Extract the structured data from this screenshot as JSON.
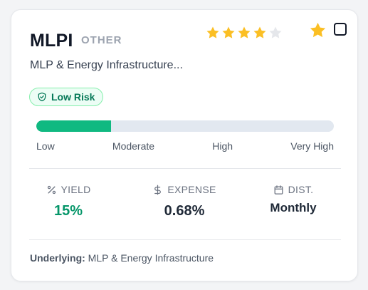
{
  "fund": {
    "ticker": "MLPI",
    "category": "OTHER",
    "name": "MLP & Energy Infrastructure...",
    "rating": 4,
    "rating_max": 5,
    "favorite": true,
    "selected": false
  },
  "risk": {
    "badge_label": "Low Risk",
    "level_fraction": 0.25,
    "levels": [
      "Low",
      "Moderate",
      "High",
      "Very High"
    ]
  },
  "stats": {
    "yield": {
      "label": "YIELD",
      "value": "15%"
    },
    "expense": {
      "label": "EXPENSE",
      "value": "0.68%"
    },
    "distribution": {
      "label": "DIST.",
      "value": "Monthly"
    }
  },
  "underlying": {
    "label": "Underlying:",
    "value": "MLP & Energy Infrastructure"
  },
  "icons": {
    "rating": "star-icon",
    "favorite": "star-icon",
    "risk": "shield-check-icon",
    "yield": "percent-icon",
    "expense": "dollar-icon",
    "distribution": "calendar-icon"
  },
  "colors": {
    "star_filled": "#fbbf24",
    "star_empty": "#e5e7eb",
    "risk_green": "#10b981",
    "risk_badge_text": "#047857",
    "yield_value": "#059669",
    "track": "#e2e8f0"
  }
}
